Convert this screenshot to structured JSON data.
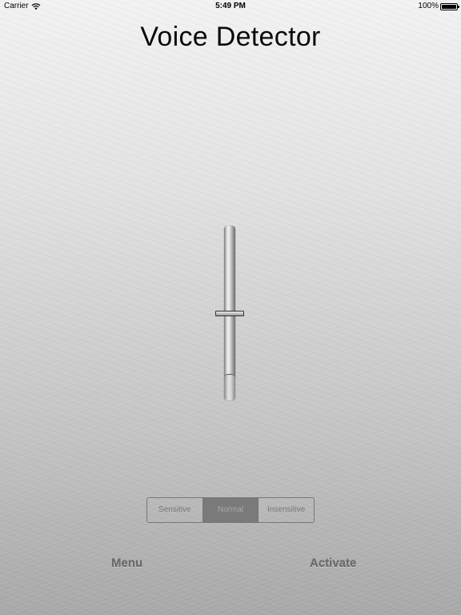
{
  "status_bar": {
    "carrier": "Carrier",
    "time": "5:49 PM",
    "battery_percent": "100%",
    "battery_level": 1.0,
    "wifi_icon": "wifi-icon",
    "battery_icon": "battery-icon"
  },
  "title": "Voice Detector",
  "slider": {
    "value": 0.5
  },
  "sensitivity": {
    "options": [
      "Sensitive",
      "Normal",
      "Insensitive"
    ],
    "selected": "Normal"
  },
  "toolbar": {
    "menu_label": "Menu",
    "activate_label": "Activate"
  },
  "colors": {
    "background_top": "#f2f2f2",
    "background_bottom": "#a8a8a8",
    "segment_selected": "#7a7a7a",
    "button_text": "#6a6a6a"
  }
}
